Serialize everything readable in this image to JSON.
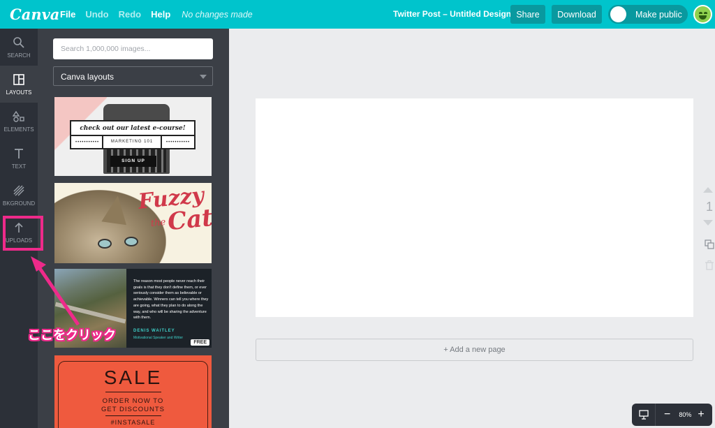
{
  "header": {
    "logo": "Canva",
    "menu": [
      "File",
      "Undo",
      "Redo",
      "Help"
    ],
    "status": "No changes made",
    "doc_title": "Twitter Post – Untitled Design",
    "share_label": "Share",
    "download_label": "Download",
    "make_public_label": "Make public"
  },
  "sidebar": {
    "items": [
      {
        "label": "SEARCH",
        "icon": "search-icon"
      },
      {
        "label": "LAYOUTS",
        "icon": "layouts-icon"
      },
      {
        "label": "ELEMENTS",
        "icon": "elements-icon"
      },
      {
        "label": "TEXT",
        "icon": "text-icon"
      },
      {
        "label": "BKGROUND",
        "icon": "background-icon"
      },
      {
        "label": "UPLOADS",
        "icon": "upload-icon"
      }
    ],
    "active": "LAYOUTS"
  },
  "panel": {
    "search_placeholder": "Search 1,000,000 images...",
    "select_value": "Canva layouts",
    "layouts": [
      {
        "heading": "check out our latest e-course!",
        "subheading": "MARKETING 101",
        "button": "SIGN UP"
      },
      {
        "line1": "Fuzzy",
        "line2": "the",
        "line3": "Cat"
      },
      {
        "quote": "The reason most people never reach their goals is that they don't define them, or ever seriously consider them as believable or achievable. Winners can tell you where they are going, what they plan to do along the way, and who will be sharing the adventure with them.",
        "author": "DENIS WAITLEY",
        "role": "Motivational Speaker and Writer",
        "badge": "FREE"
      },
      {
        "title": "SALE",
        "line1": "ORDER NOW TO",
        "line2": "GET DISCOUNTS",
        "tag": "#INSTASALE"
      }
    ]
  },
  "annotation": {
    "text": "ここをクリック",
    "color": "#ee2a8a"
  },
  "canvas": {
    "add_page_label": "+ Add a new page",
    "page_number": "1",
    "zoom": "80%",
    "zoom_minus": "−",
    "zoom_plus": "+"
  },
  "colors": {
    "brand": "#00c4cc",
    "nav_bg": "#2c3038",
    "panel_bg": "#3b3f46",
    "highlight": "#ee2a8a"
  }
}
